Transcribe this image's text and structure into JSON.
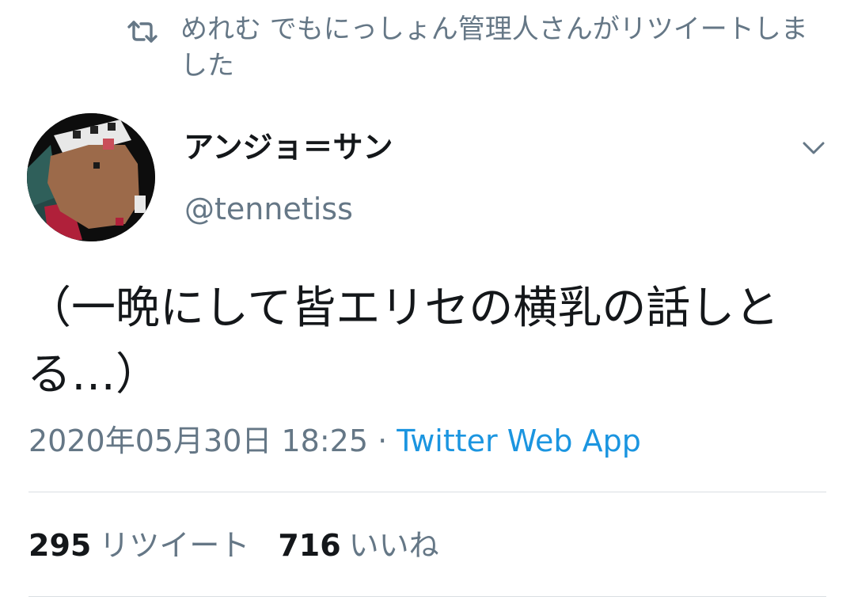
{
  "retweet_context": {
    "icon": "retweet-icon",
    "text": "めれむ でもにっしょん管理人さんがリツイートしました"
  },
  "author": {
    "display_name": "アンジョ＝サン",
    "handle": "@tennetiss",
    "avatar": "avatar-image"
  },
  "menu_icon": "chevron-down-icon",
  "tweet": {
    "text": "（一晩にして皆エリセの横乳の話しとる…）"
  },
  "meta": {
    "timestamp": "2020年05月30日 18:25",
    "separator": " · ",
    "source": "Twitter Web App"
  },
  "stats": {
    "retweets_count": "295",
    "retweets_label": "リツイート",
    "likes_count": "716",
    "likes_label": "いいね"
  },
  "colors": {
    "text_primary": "#14171a",
    "text_secondary": "#657786",
    "link": "#1b95e0",
    "divider": "#d9dee2"
  }
}
